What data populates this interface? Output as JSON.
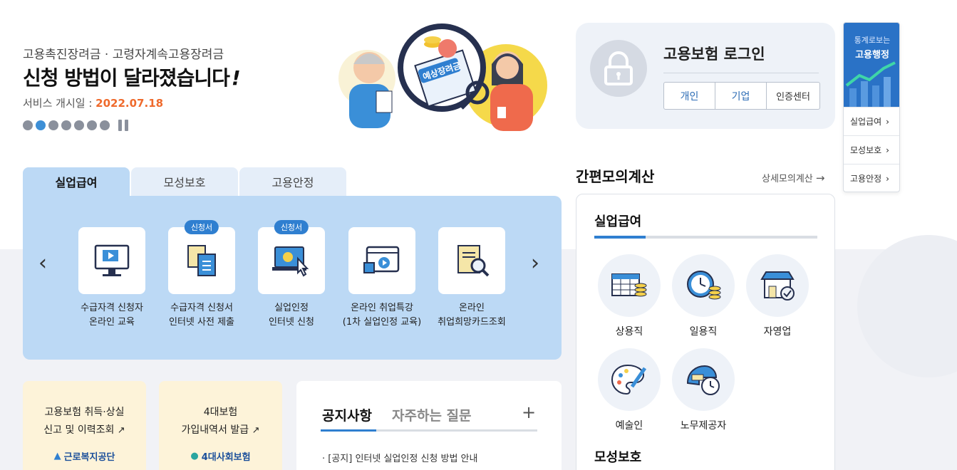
{
  "hero": {
    "subtitle": "고용촉진장려금 · 고령자계속고용장려금",
    "title": "신청 방법이 달라졌습니다",
    "title_mark": "!",
    "date_label": "서비스 개시일 : ",
    "date_value": "2022.07.18",
    "illustration_sign": "예상장려금"
  },
  "login": {
    "title": "고용보험 로그인",
    "buttons": [
      "개인",
      "기업",
      "인증센터"
    ]
  },
  "side_widget": {
    "line1": "통계로보는",
    "line2": "고용행정",
    "links": [
      "실업급여",
      "모성보호",
      "고용안정"
    ],
    "accent": "#2a72c6"
  },
  "tabs": [
    "실업급여",
    "모성보호",
    "고용안정"
  ],
  "services": [
    {
      "label1": "수급자격 신청자",
      "label2": "온라인 교육",
      "badge": "",
      "icon": "monitor-play-icon"
    },
    {
      "label1": "수급자격 신청서",
      "label2": "인터넷 사전 제출",
      "badge": "신청서",
      "icon": "documents-icon"
    },
    {
      "label1": "실업인정",
      "label2": "인터넷 신청",
      "badge": "신청서",
      "icon": "laptop-click-icon"
    },
    {
      "label1": "온라인 취업특강",
      "label2": "(1차 실업인정 교육)",
      "badge": "",
      "icon": "video-window-icon"
    },
    {
      "label1": "온라인",
      "label2": "취업희망카드조회",
      "badge": "",
      "icon": "card-search-icon"
    }
  ],
  "cards": [
    {
      "line1": "고용보험 취득·상실",
      "line2": "신고 및 이력조회",
      "logo": "근로복지공단"
    },
    {
      "line1": "4대보험",
      "line2": "가입내역서 발급",
      "logo": "4대사회보험"
    }
  ],
  "notice": {
    "tab_active": "공지사항",
    "tab_inactive": "자주하는 질문",
    "plus": "+",
    "item": "[공지] 인터넷 실업인정 신청 방법 안내"
  },
  "calc": {
    "title": "간편모의계산",
    "more": "상세모의계산",
    "section1": "실업급여",
    "section2": "모성보호",
    "items": [
      "상용직",
      "일용직",
      "자영업",
      "예술인",
      "노무제공자"
    ]
  },
  "colors": {
    "accent_blue": "#2f7fd0",
    "date_orange": "#ef6a2c",
    "panel_blue": "#bcd9f5",
    "card_yellow": "#fdf3d9"
  }
}
